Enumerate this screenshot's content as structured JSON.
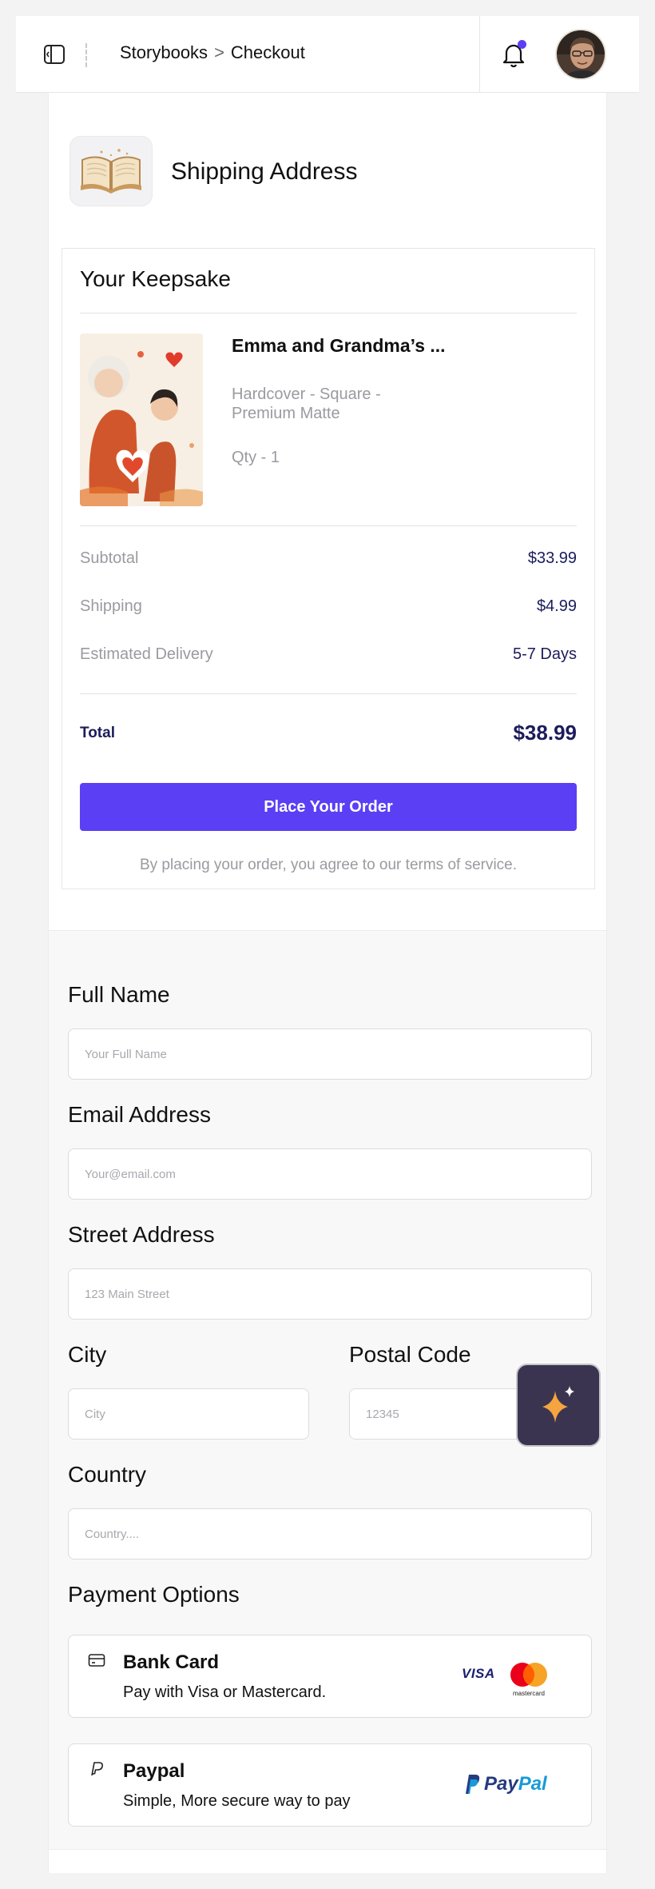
{
  "header": {
    "breadcrumb": [
      "Storybooks",
      "Checkout"
    ],
    "breadcrumb_separator": ">",
    "notification_dot_color": "#5b3ff5"
  },
  "shipping": {
    "title": "Shipping Address"
  },
  "keepsake": {
    "title": "Your Keepsake",
    "book_title": "Emma and Grandma’s ...",
    "variant": "Hardcover - Square - Premium Matte",
    "qty": "Qty - 1",
    "summary": [
      {
        "label": "Subtotal",
        "value": "$33.99"
      },
      {
        "label": "Shipping",
        "value": "$4.99"
      },
      {
        "label": "Estimated Delivery",
        "value": "5-7 Days"
      }
    ],
    "total_label": "Total",
    "total_value": "$38.99",
    "place_order_label": "Place Your Order",
    "terms": "By placing your order, you agree to our terms of service.",
    "accent_color": "#5a3ff5"
  },
  "form": {
    "full_name": {
      "label": "Full Name",
      "placeholder": "Your Full Name",
      "value": ""
    },
    "email": {
      "label": "Email Address",
      "placeholder": "Your@email.com",
      "value": ""
    },
    "street": {
      "label": "Street Address",
      "placeholder": "123 Main Street",
      "value": ""
    },
    "city": {
      "label": "City",
      "placeholder": "City",
      "value": ""
    },
    "postal": {
      "label": "Postal Code",
      "placeholder": "12345",
      "value": ""
    },
    "country": {
      "label": "Country",
      "placeholder": "Country....",
      "value": ""
    }
  },
  "payment": {
    "title": "Payment Options",
    "options": [
      {
        "name": "Bank Card",
        "description": "Pay with Visa or Mastercard.",
        "icon": "credit-card-icon",
        "brands": [
          "VISA",
          "mastercard"
        ]
      },
      {
        "name": "Paypal",
        "description": "Simple, More secure way to pay",
        "icon": "paypal-icon",
        "brand": "PayPal"
      }
    ]
  }
}
